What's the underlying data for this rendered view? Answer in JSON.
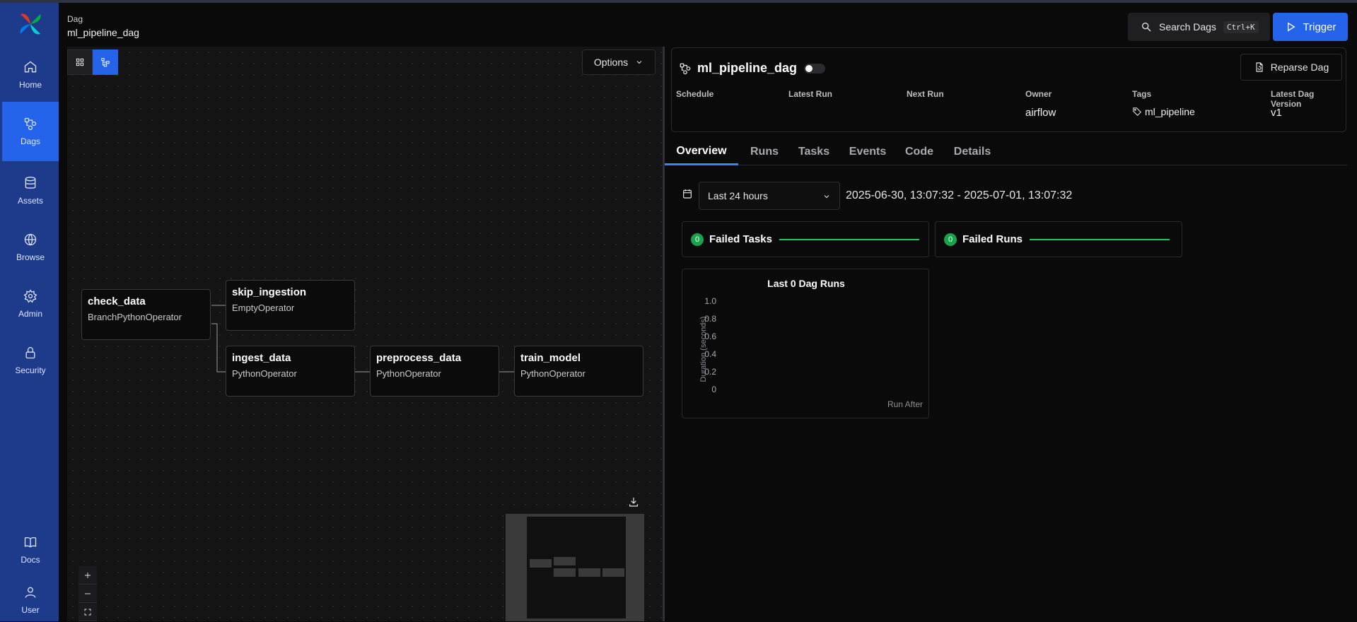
{
  "header": {
    "crumb_label": "Dag",
    "crumb_value": "ml_pipeline_dag",
    "search_label": "Search Dags",
    "search_shortcut": "Ctrl+K",
    "trigger_label": "Trigger"
  },
  "sidebar": {
    "items": [
      {
        "label": "Home",
        "icon": "home-icon"
      },
      {
        "label": "Dags",
        "icon": "dags-icon",
        "active": true
      },
      {
        "label": "Assets",
        "icon": "database-icon"
      },
      {
        "label": "Browse",
        "icon": "globe-icon"
      },
      {
        "label": "Admin",
        "icon": "gear-icon"
      },
      {
        "label": "Security",
        "icon": "lock-icon"
      },
      {
        "label": "Docs",
        "icon": "book-icon"
      },
      {
        "label": "User",
        "icon": "user-icon"
      }
    ]
  },
  "graph": {
    "options_label": "Options",
    "nodes": [
      {
        "name": "check_data",
        "operator": "BranchPythonOperator"
      },
      {
        "name": "skip_ingestion",
        "operator": "EmptyOperator"
      },
      {
        "name": "ingest_data",
        "operator": "PythonOperator"
      },
      {
        "name": "preprocess_data",
        "operator": "PythonOperator"
      },
      {
        "name": "train_model",
        "operator": "PythonOperator"
      }
    ]
  },
  "dag": {
    "title": "ml_pipeline_dag",
    "reparse_label": "Reparse Dag",
    "meta": {
      "schedule_label": "Schedule",
      "latest_run_label": "Latest Run",
      "next_run_label": "Next Run",
      "owner_label": "Owner",
      "owner_value": "airflow",
      "tags_label": "Tags",
      "tags_value": "ml_pipeline",
      "version_label": "Latest Dag Version",
      "version_value": "v1"
    },
    "tabs": [
      "Overview",
      "Runs",
      "Tasks",
      "Events",
      "Code",
      "Details"
    ],
    "active_tab": "Overview"
  },
  "overview": {
    "range_select": "Last 24 hours",
    "range_text": "2025-06-30, 13:07:32 - 2025-07-01, 13:07:32",
    "failed_tasks": {
      "count": "0",
      "label": "Failed Tasks"
    },
    "failed_runs": {
      "count": "0",
      "label": "Failed Runs"
    }
  },
  "chart_data": {
    "type": "bar",
    "title": "Last 0 Dag Runs",
    "ylabel": "Duration (seconds)",
    "xlabel": "Run After",
    "categories": [],
    "values": [],
    "ylim": [
      0,
      1.0
    ],
    "yticks": [
      "1.0",
      "0.8",
      "0.6",
      "0.4",
      "0.2",
      "0"
    ]
  },
  "colors": {
    "sidebar": "#1e3a8a",
    "accent": "#2563eb",
    "success": "#16a34a"
  }
}
